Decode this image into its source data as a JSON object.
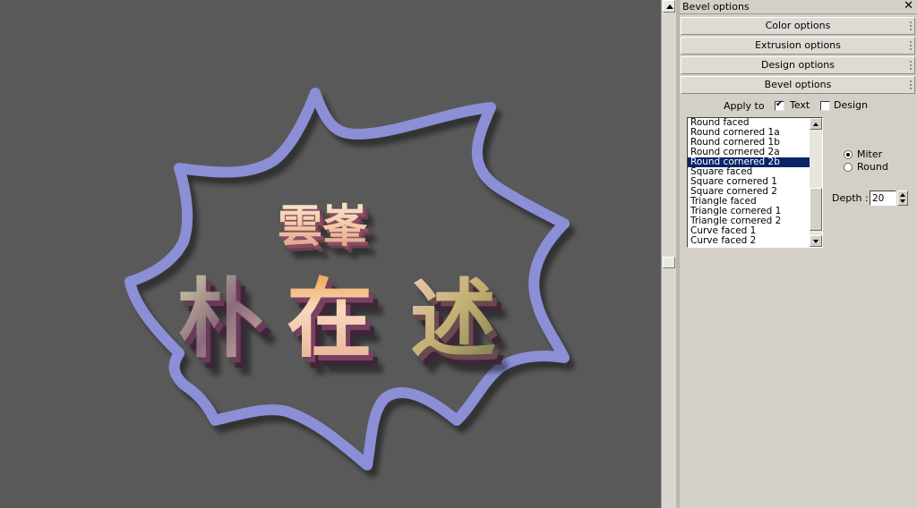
{
  "canvas": {
    "line1": "雲峯",
    "line2_chars": [
      "朴",
      "在",
      "述"
    ],
    "burst_color": "#8b8fd6",
    "background": "#595959"
  },
  "panel": {
    "title": "Bevel options",
    "close_glyph": "✕",
    "sections": [
      "Color options",
      "Extrusion options",
      "Design options",
      "Bevel options"
    ],
    "apply_to": {
      "label": "Apply to",
      "text_label": "Text",
      "text_checked": true,
      "design_label": "Design",
      "design_checked": false
    },
    "bevel_list": {
      "items": [
        "Round faced",
        "Round cornered 1a",
        "Round cornered 1b",
        "Round cornered 2a",
        "Round cornered 2b",
        "Square faced",
        "Square cornered 1",
        "Square cornered 2",
        "Triangle faced",
        "Triangle cornered 1",
        "Triangle cornered 2",
        "Curve faced 1",
        "Curve faced 2"
      ],
      "selected": "Round cornered 2b"
    },
    "corner": {
      "miter_label": "Miter",
      "round_label": "Round",
      "selected": "Miter"
    },
    "depth": {
      "label": "Depth :",
      "value": "20"
    }
  }
}
